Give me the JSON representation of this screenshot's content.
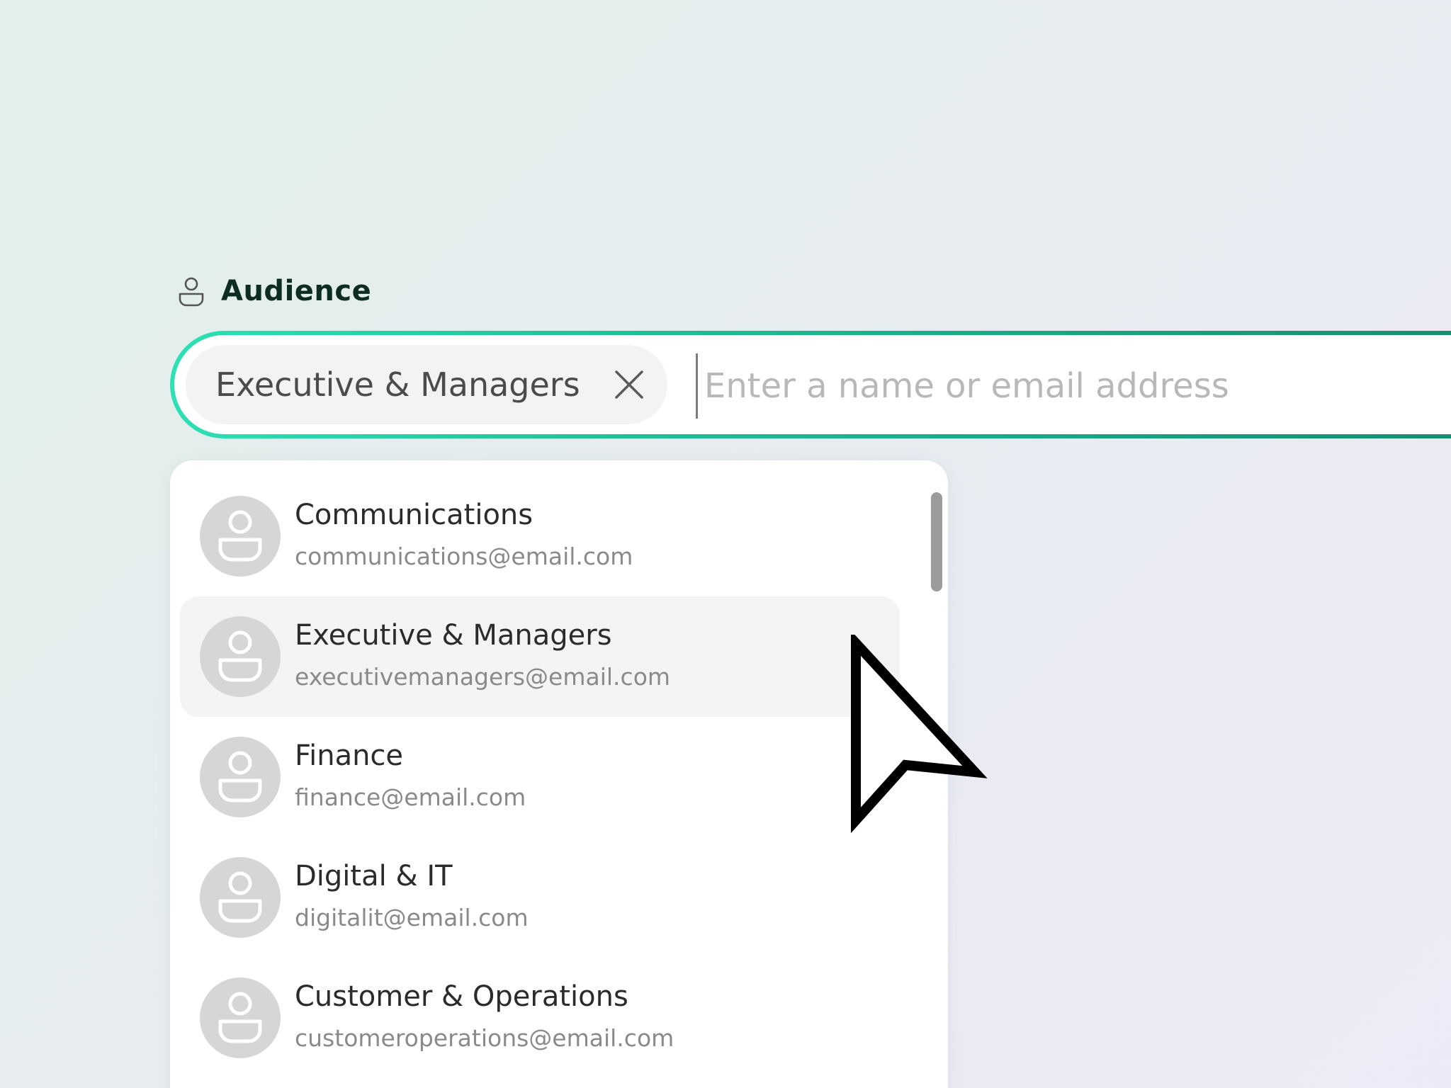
{
  "audience": {
    "title": "Audience",
    "icon": "person-outline-icon"
  },
  "search": {
    "placeholder": "Enter a name or email address",
    "value": "",
    "border_gradient": [
      "#2ee0b4",
      "#158a6e"
    ]
  },
  "selected_chips": [
    {
      "label": "Executive & Managers",
      "remove_icon": "close-icon"
    }
  ],
  "dropdown": {
    "items": [
      {
        "name": "Communications",
        "email": "communications@email.com",
        "highlighted": false
      },
      {
        "name": "Executive & Managers",
        "email": "executivemanagers@email.com",
        "highlighted": true
      },
      {
        "name": "Finance",
        "email": "finance@email.com",
        "highlighted": false
      },
      {
        "name": "Digital & IT",
        "email": "digitalit@email.com",
        "highlighted": false
      },
      {
        "name": "Customer & Operations",
        "email": "customeroperations@email.com",
        "highlighted": false
      }
    ],
    "avatar_icon": "person-avatar-icon"
  },
  "colors": {
    "title": "#0d2d24",
    "chip_bg": "#f3f3f3",
    "highlight_bg": "#f4f4f4",
    "avatar_bg": "#d6d6d6"
  }
}
